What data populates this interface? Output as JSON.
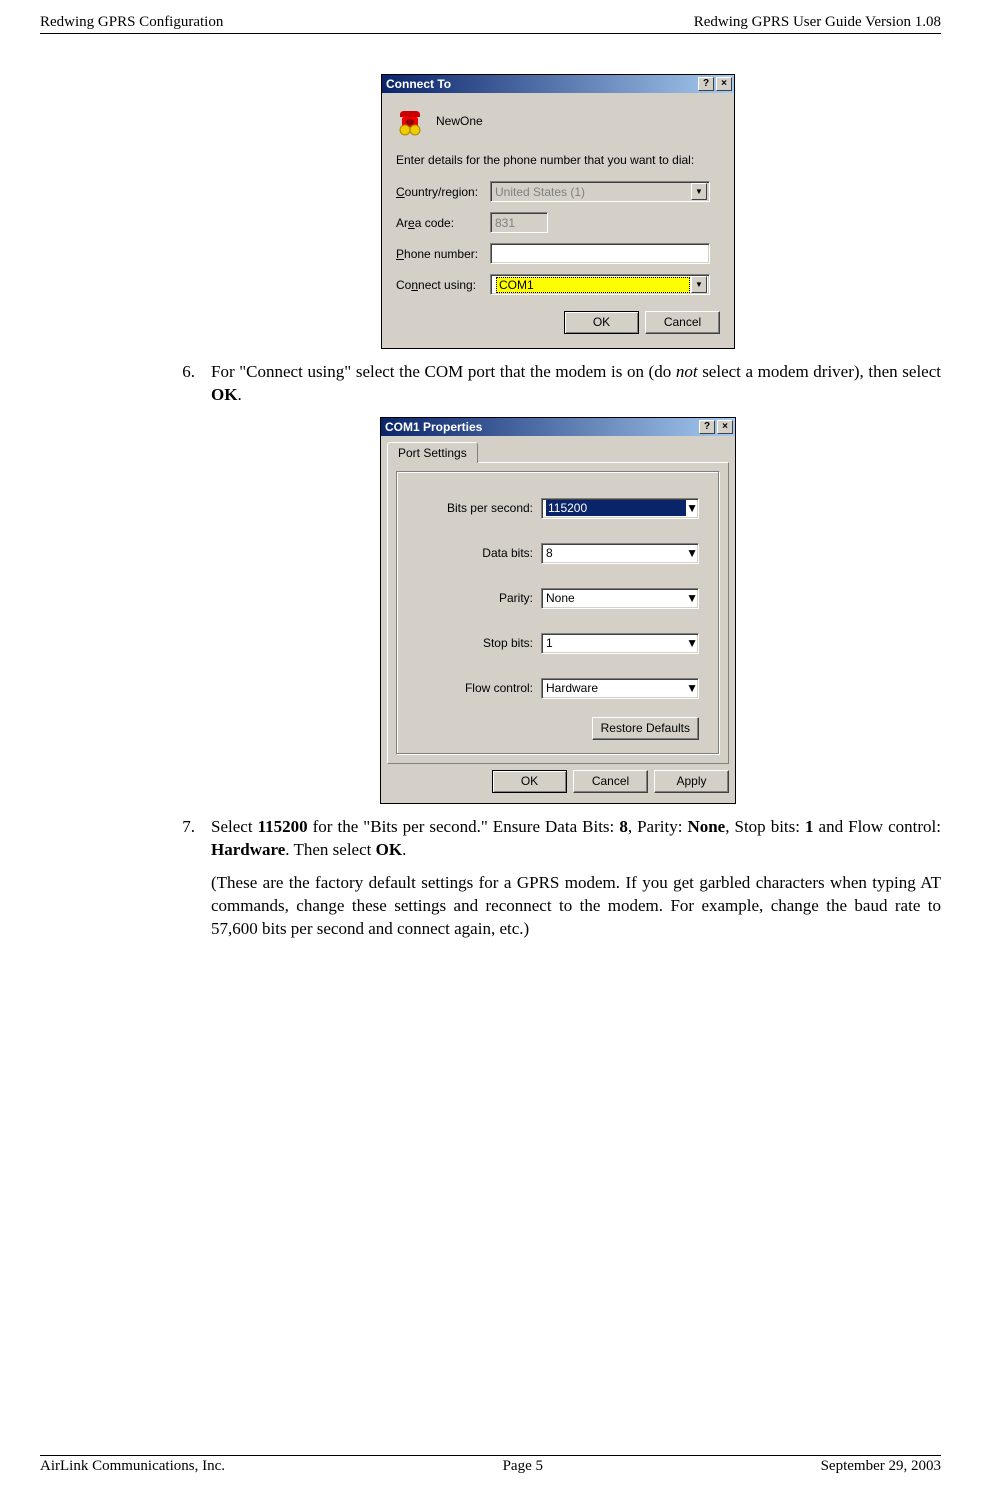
{
  "header": {
    "left": "Redwing GPRS Configuration",
    "right": "Redwing GPRS User Guide Version 1.08"
  },
  "footer": {
    "left": "AirLink Communications, Inc.",
    "center": "Page 5",
    "right": "September 29, 2003"
  },
  "dialog1": {
    "title": "Connect To",
    "connection_name": "NewOne",
    "instruction": "Enter details for the phone number that you want to dial:",
    "country_label_pre": "C",
    "country_label_post": "ountry/region:",
    "country_value": "United States (1)",
    "area_label_pre": "Ar",
    "area_label_u": "e",
    "area_label_post": "a code:",
    "area_value": "831",
    "phone_label_u": "P",
    "phone_label_post": "hone number:",
    "phone_value": "",
    "connect_label_pre": "Co",
    "connect_label_u": "n",
    "connect_label_post": "nect using:",
    "connect_value": "COM1",
    "ok": "OK",
    "cancel": "Cancel"
  },
  "step6": {
    "num": "6.",
    "t1": "For \"Connect using\" select the COM port that the modem is on (do ",
    "not": "not",
    "t2": " select a modem driver), then select ",
    "ok": "OK",
    "t3": "."
  },
  "dialog2": {
    "title": "COM1 Properties",
    "tab": "Port Settings",
    "bits_label_u": "B",
    "bits_label": "its per second:",
    "bits_value": "115200",
    "data_label_u": "D",
    "data_label": "ata bits:",
    "data_value": "8",
    "parity_label_u": "P",
    "parity_label": "arity:",
    "parity_value": "None",
    "stop_label_u": "S",
    "stop_label": "top bits:",
    "stop_value": "1",
    "flow_label_u": "F",
    "flow_label": "low control:",
    "flow_value": "Hardware",
    "restore_u": "R",
    "restore": "estore Defaults",
    "ok": "OK",
    "cancel": "Cancel",
    "apply_u": "A",
    "apply": "pply"
  },
  "step7": {
    "num": "7.",
    "t1": "Select ",
    "b1": "115200",
    "t2": " for the \"Bits per second.\" Ensure Data Bits: ",
    "b2": "8",
    "t3": ", Parity: ",
    "b3": "None",
    "t4": ", Stop bits: ",
    "b4": "1",
    "t5": " and Flow control: ",
    "b5": "Hardware",
    "t6": ". Then select ",
    "b6": "OK",
    "t7": ".",
    "p2": "(These are the factory default settings for a GPRS modem. If you get garbled characters when typing AT commands, change these settings and reconnect to the modem. For example, change the baud rate to 57,600 bits per second and connect again, etc.)"
  }
}
